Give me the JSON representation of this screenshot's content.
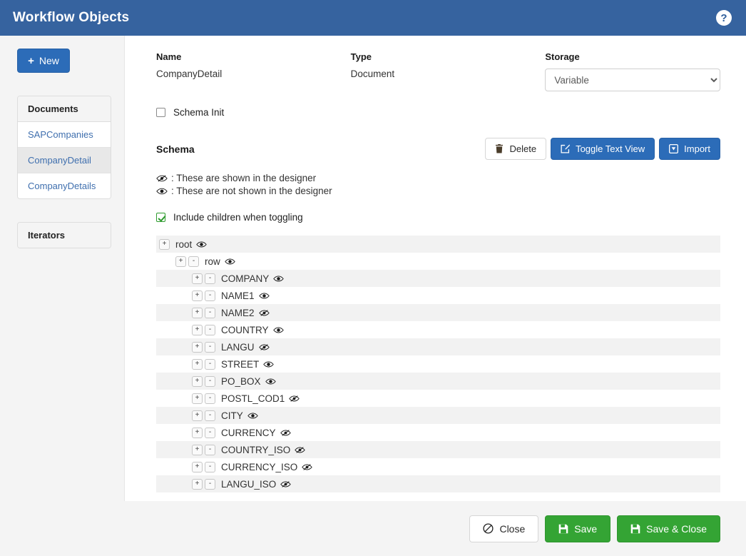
{
  "header": {
    "title": "Workflow Objects",
    "help_label": "?"
  },
  "sidebar": {
    "new_button": {
      "label": "New",
      "icon": "plus-icon"
    },
    "panels": [
      {
        "title": "Documents",
        "items": [
          {
            "label": "SAPCompanies",
            "active": false
          },
          {
            "label": "CompanyDetail",
            "active": true
          },
          {
            "label": "CompanyDetails",
            "active": false
          }
        ]
      },
      {
        "title": "Iterators",
        "items": []
      }
    ]
  },
  "form": {
    "name_label": "Name",
    "name_value": "CompanyDetail",
    "type_label": "Type",
    "type_value": "Document",
    "storage_label": "Storage",
    "storage_value": "Variable",
    "storage_options": [
      "Variable"
    ],
    "schema_init_label": "Schema Init",
    "schema_init_checked": false
  },
  "schema": {
    "title": "Schema",
    "buttons": [
      {
        "label": "Delete",
        "icon": "trash-icon",
        "style": "light"
      },
      {
        "label": "Toggle Text View",
        "icon": "edit-icon",
        "style": "primary"
      },
      {
        "label": "Import",
        "icon": "import-icon",
        "style": "primary"
      }
    ],
    "legend": [
      {
        "icon": "eye-slash-icon",
        "text": ": These are shown in the designer"
      },
      {
        "icon": "eye-icon",
        "text": ": These are not shown in the designer"
      }
    ],
    "include_children_label": "Include children when toggling",
    "include_children_checked": true
  },
  "tree": {
    "expand_label": "+",
    "collapse_label": "-",
    "rows": [
      {
        "label": "root",
        "depth": 0,
        "buttons": [
          "+"
        ],
        "visibility": "eye-icon"
      },
      {
        "label": "row",
        "depth": 1,
        "buttons": [
          "+",
          "-"
        ],
        "visibility": "eye-icon"
      },
      {
        "label": "COMPANY",
        "depth": 2,
        "buttons": [
          "+",
          "-"
        ],
        "visibility": "eye-icon"
      },
      {
        "label": "NAME1",
        "depth": 2,
        "buttons": [
          "+",
          "-"
        ],
        "visibility": "eye-icon"
      },
      {
        "label": "NAME2",
        "depth": 2,
        "buttons": [
          "+",
          "-"
        ],
        "visibility": "eye-slash-icon"
      },
      {
        "label": "COUNTRY",
        "depth": 2,
        "buttons": [
          "+",
          "-"
        ],
        "visibility": "eye-icon"
      },
      {
        "label": "LANGU",
        "depth": 2,
        "buttons": [
          "+",
          "-"
        ],
        "visibility": "eye-slash-icon"
      },
      {
        "label": "STREET",
        "depth": 2,
        "buttons": [
          "+",
          "-"
        ],
        "visibility": "eye-icon"
      },
      {
        "label": "PO_BOX",
        "depth": 2,
        "buttons": [
          "+",
          "-"
        ],
        "visibility": "eye-icon"
      },
      {
        "label": "POSTL_COD1",
        "depth": 2,
        "buttons": [
          "+",
          "-"
        ],
        "visibility": "eye-slash-icon"
      },
      {
        "label": "CITY",
        "depth": 2,
        "buttons": [
          "+",
          "-"
        ],
        "visibility": "eye-icon"
      },
      {
        "label": "CURRENCY",
        "depth": 2,
        "buttons": [
          "+",
          "-"
        ],
        "visibility": "eye-slash-icon"
      },
      {
        "label": "COUNTRY_ISO",
        "depth": 2,
        "buttons": [
          "+",
          "-"
        ],
        "visibility": "eye-slash-icon"
      },
      {
        "label": "CURRENCY_ISO",
        "depth": 2,
        "buttons": [
          "+",
          "-"
        ],
        "visibility": "eye-slash-icon"
      },
      {
        "label": "LANGU_ISO",
        "depth": 2,
        "buttons": [
          "+",
          "-"
        ],
        "visibility": "eye-slash-icon"
      }
    ]
  },
  "footer": {
    "buttons": [
      {
        "label": "Close",
        "icon": "ban-icon",
        "style": "light"
      },
      {
        "label": "Save",
        "icon": "save-icon",
        "style": "green"
      },
      {
        "label": "Save & Close",
        "icon": "save-icon",
        "style": "green"
      }
    ]
  },
  "colors": {
    "header_blue": "#36639f",
    "primary_blue": "#2c6cb8",
    "green": "#34a434",
    "link_blue": "#3f6fae",
    "page_bg": "#f4f4f4"
  }
}
